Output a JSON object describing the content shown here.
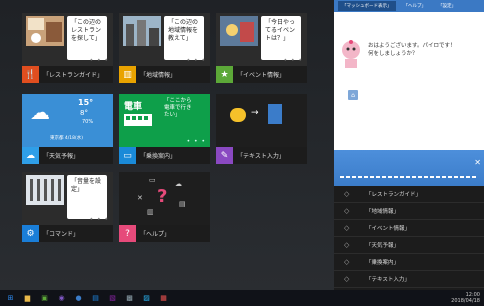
{
  "tiles": [
    {
      "label": "「レストランガイド」",
      "note": "「この辺の\nレストラン\nを探して」",
      "icon": "restaurant-icon",
      "glyph": "🍴",
      "color": "#e04e1f"
    },
    {
      "label": "「地域情報」",
      "note": "「この辺の\n地域情報を\n教えて」",
      "icon": "building-icon",
      "glyph": "▥",
      "color": "#e9a300"
    },
    {
      "label": "「イベント情報」",
      "note": "「今日やっ\nてるイベン\nトは？」",
      "icon": "event-icon",
      "glyph": "★",
      "color": "#5ca838"
    },
    {
      "label": "「天気予報」",
      "weather": {
        "temp_high": "15°",
        "temp_low": "8°",
        "humidity": "70%",
        "date": "東京都 4/18(水)"
      },
      "icon": "weather-icon",
      "glyph": "☁",
      "color": "#2f9fe8"
    },
    {
      "label": "「乗換案内」",
      "note": "「ここから\n電車で行き\nたい」",
      "heading": "電車",
      "icon": "train-icon",
      "glyph": "▭",
      "color": "#1a8ad8"
    },
    {
      "label": "「テキスト入力」",
      "icon": "text-input-icon",
      "glyph": "✎",
      "color": "#8a49c2"
    },
    {
      "label": "「コマンド」",
      "note": "「音量を設\n定」",
      "icon": "gear-icon",
      "glyph": "⚙",
      "color": "#1a7ed8"
    },
    {
      "label": "「ヘルプ」",
      "icon": "help-icon",
      "glyph": "?",
      "color": "#e64a7a"
    }
  ],
  "panel": {
    "tabs": [
      "「マッシュボード表示」",
      "「ヘルプ」",
      "「設定」"
    ],
    "message": "おはようございます。パイロです！\n何をしましょうか？",
    "menu": [
      "「レストランガイド」",
      "「地域情報」",
      "「イベント情報」",
      "「天気予報」",
      "「乗換案内」",
      "「テキスト入力」"
    ]
  },
  "taskbar": {
    "items": [
      {
        "icon": "windows-icon",
        "glyph": "⊞",
        "color": "#2d89ef"
      },
      {
        "icon": "folder-icon",
        "glyph": "▆",
        "color": "#e8b84a"
      },
      {
        "icon": "store-icon",
        "glyph": "▣",
        "color": "#5ca838"
      },
      {
        "icon": "media-icon",
        "glyph": "◉",
        "color": "#7e57c2"
      },
      {
        "icon": "browser-icon",
        "glyph": "●",
        "color": "#3b7cc9"
      },
      {
        "icon": "app-icon",
        "glyph": "▤",
        "color": "#1e88e5"
      },
      {
        "icon": "app-icon-2",
        "glyph": "▧",
        "color": "#8e24aa"
      },
      {
        "icon": "app-icon-3",
        "glyph": "▩",
        "color": "#90a4ae"
      },
      {
        "icon": "app-icon-4",
        "glyph": "▨",
        "color": "#29b6f6"
      },
      {
        "icon": "app-icon-5",
        "glyph": "▦",
        "color": "#ef5350"
      }
    ],
    "time": "12:00",
    "date": "2018/04/18"
  }
}
